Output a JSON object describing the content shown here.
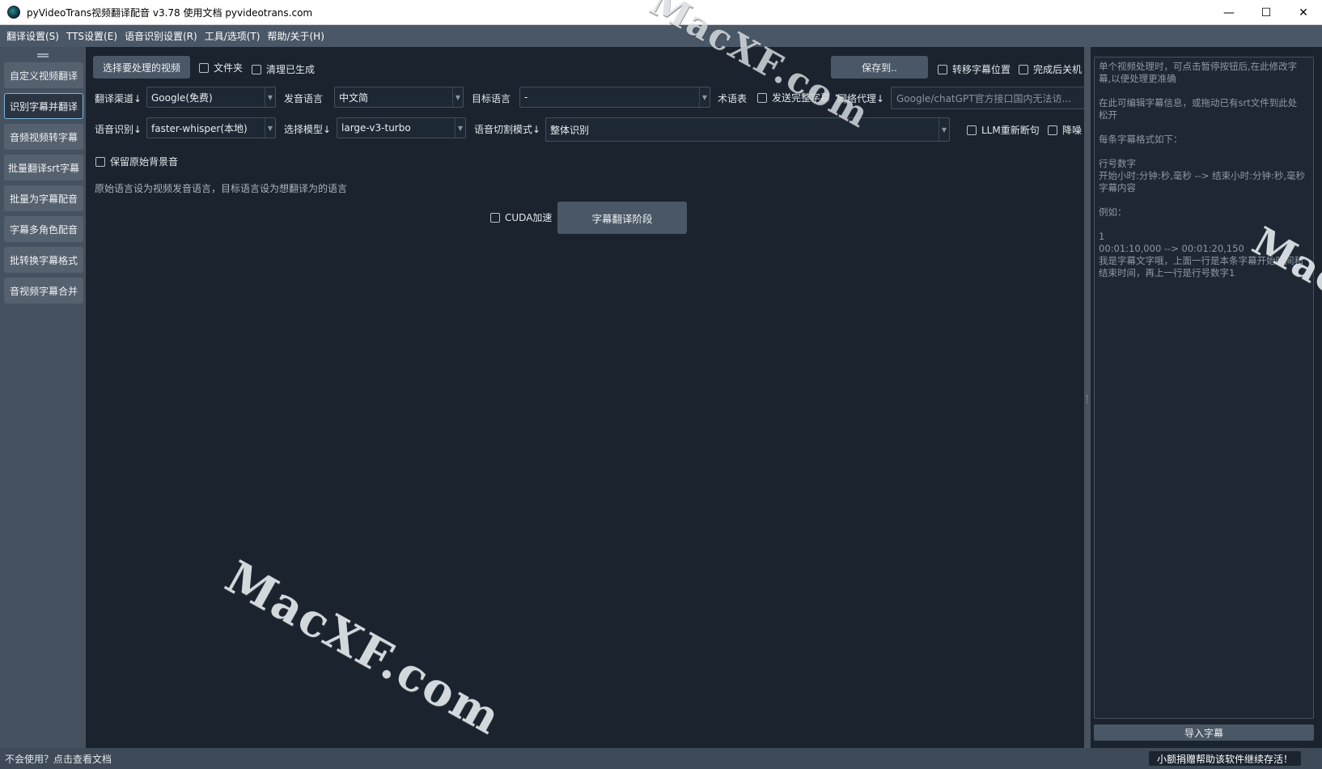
{
  "window": {
    "title": "pyVideoTrans视频翻译配音 v3.78  使用文档  pyvideotrans.com",
    "minimize": "—",
    "maximize": "☐",
    "close": "✕"
  },
  "menu": [
    "翻译设置(S)",
    "TTS设置(E)",
    "语音识别设置(R)",
    "工具/选项(T)",
    "帮助/关于(H)"
  ],
  "sidebar": {
    "items": [
      "自定义视频翻译",
      "识别字幕并翻译",
      "音频视频转字幕",
      "批量翻译srt字幕",
      "批量为字幕配音",
      "字幕多角色配音",
      "批转换字幕格式",
      "音视频字幕合并"
    ],
    "active_index": 1
  },
  "main": {
    "select_video_btn": "选择要处理的视频",
    "folder_chk": "文件夹",
    "clear_generated_chk": "清理已生成",
    "save_to_btn": "保存到..",
    "move_subtitle_chk": "转移字幕位置",
    "shutdown_chk": "完成后关机",
    "translate_channel_label": "翻译渠道↓",
    "translate_channel_value": "Google(免费)",
    "source_lang_label": "发音语言",
    "source_lang_value": "中文简",
    "target_lang_label": "目标语言",
    "target_lang_value": "-",
    "glossary_label": "术语表",
    "send_full_subtitle_chk": "发送完整字幕",
    "proxy_label": "网络代理↓",
    "proxy_placeholder": "Google/chatGPT官方接口国内无法访...",
    "asr_label": "语音识别↓",
    "asr_value": "faster-whisper(本地)",
    "model_label": "选择模型↓",
    "model_value": "large-v3-turbo",
    "split_mode_label": "语音切割模式↓",
    "split_mode_value": "整体识别",
    "llm_resplit_chk": "LLM重新断句",
    "denoise_chk": "降噪",
    "keep_bg_chk": "保留原始背景音",
    "hint_text": "原始语言设为视频发音语言，目标语言设为想翻译为的语言",
    "cuda_chk": "CUDA加速",
    "stage_btn": "字幕翻译阶段"
  },
  "right_panel": {
    "lines": [
      "单个视频处理时，可点击暂停按钮后,在此修改字",
      "幕,以便处理更准确",
      "",
      " 在此可编辑字幕信息，或拖动已有srt文件到此处",
      "松开",
      "",
      "每条字幕格式如下：",
      "",
      "行号数字",
      "开始小时:分钟:秒,毫秒 --> 结束小时:分钟:秒,毫秒",
      "字幕内容",
      "",
      "例如：",
      "",
      "1",
      "00:01:10,000 --> 00:01:20,150",
      "我是字幕文字哦，上面一行是本条字幕开始时间和",
      "结束时间，再上一行是行号数字1"
    ],
    "import_btn": "导入字幕"
  },
  "status": {
    "left": "不会使用？点击查看文档",
    "right": "小额捐赠帮助该软件继续存活！"
  },
  "watermark": "MacXF.com",
  "colors": {
    "background": "#1a232e",
    "menubar": "#4a5766",
    "sidebar": "#45515e",
    "active_border": "#7fb3d9"
  }
}
